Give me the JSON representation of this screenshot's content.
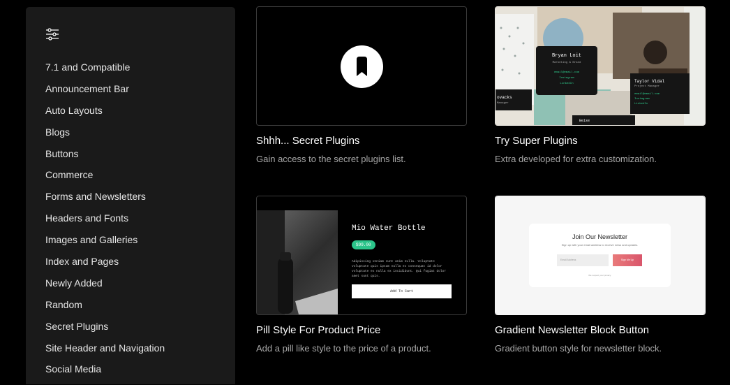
{
  "sidebar": {
    "filter_icon": "sliders-icon",
    "categories": [
      "7.1 and Compatible",
      "Announcement Bar",
      "Auto Layouts",
      "Blogs",
      "Buttons",
      "Commerce",
      "Forms and Newsletters",
      "Headers and Fonts",
      "Images and Galleries",
      "Index and Pages",
      "Newly Added",
      "Random",
      "Secret Plugins",
      "Site Header and Navigation",
      "Social Media"
    ]
  },
  "cards": [
    {
      "title": "Shhh... Secret Plugins",
      "description": "Gain access to the secret plugins list.",
      "icon": "bookmark-badge-icon"
    },
    {
      "title": "Try Super Plugins",
      "description": "Extra developed for extra customization.",
      "preview": {
        "name1": "Bryan Loit",
        "role1": "Marketing & Brand",
        "links1": [
          "email@email.com",
          "Instagram",
          "LinkedIn"
        ],
        "name2": "Taylor Vidal",
        "role2": "Project Manager",
        "links2": [
          "email@email.com",
          "Instagram",
          "LinkedIn"
        ],
        "name3": "ovacks",
        "role3": "Manager",
        "name4": "Beise"
      }
    },
    {
      "title": "Pill Style For Product Price",
      "description": "Add a pill like style to the price of a product.",
      "preview": {
        "product_name": "Mio Water Bottle",
        "price": "$99.00",
        "text": "Adipiscing veniam sunt anim nulla. Voluptate voluptate quis ipsum nulla ex consequat id dolor voluptate ex nulla ex incididunt. Qui fugiat dolor amet sunt quis.",
        "button": "Add To Cart"
      }
    },
    {
      "title": "Gradient Newsletter Block Button",
      "description": "Gradient button style for newsletter block.",
      "preview": {
        "heading": "Join Our Newsletter",
        "subheading": "Sign up with your email address to receive news and updates.",
        "input_placeholder": "Email Address",
        "button": "Sign Me Up",
        "note": "We respect your privacy."
      }
    }
  ]
}
